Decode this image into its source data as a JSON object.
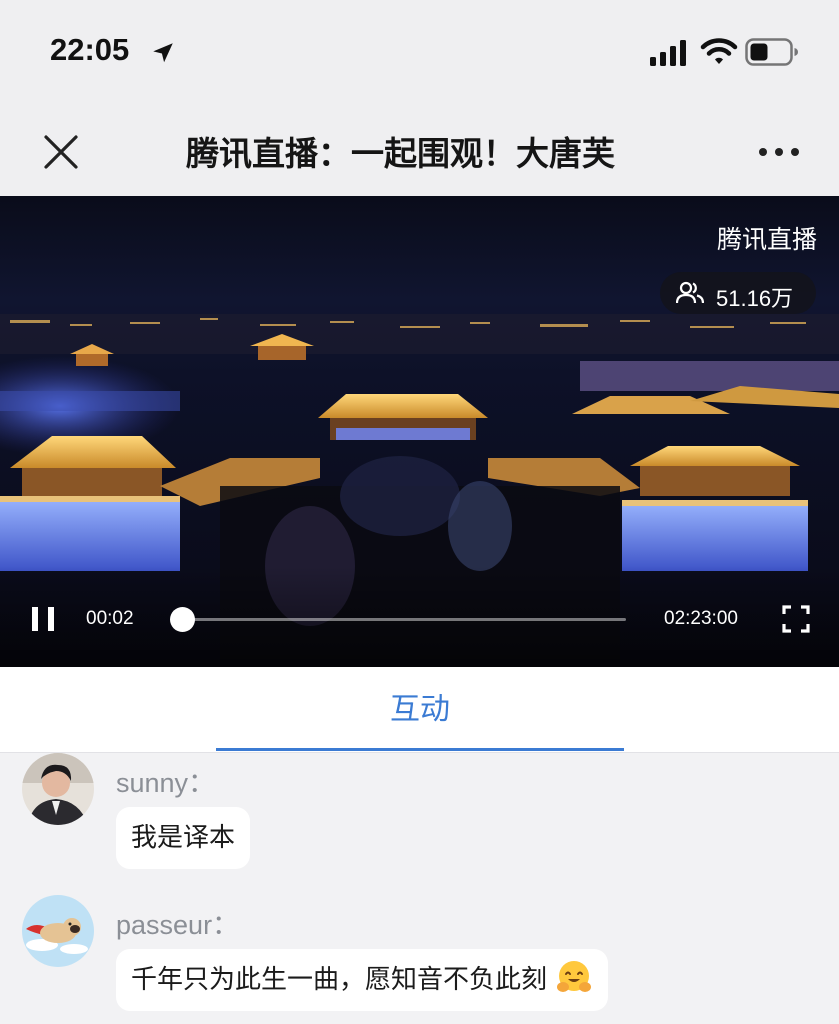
{
  "status_bar": {
    "time": "22:05",
    "icons": [
      "location-arrow-icon",
      "signal-icon",
      "wifi-icon",
      "battery-icon"
    ]
  },
  "nav": {
    "title": "腾讯直播：一起围观！大唐芙",
    "close_icon": "close-icon",
    "more_icon": "more-icon"
  },
  "video": {
    "channel": "腾讯直播",
    "viewers": "51.16万",
    "current_time": "00:02",
    "total_time": "02:23:00",
    "progress_fraction": 0.0002
  },
  "tabs": [
    {
      "label": "互动",
      "active": true
    }
  ],
  "comments": [
    {
      "user": "sunny：",
      "text": "我是译本"
    },
    {
      "user": "passeur：",
      "text": "千年只为此生一曲，愿知音不负此刻",
      "emoji": "hugging-face-emoji"
    }
  ],
  "colors": {
    "accent": "#3b7bd3",
    "background": "#f2f2f4",
    "username": "#8b8f96"
  }
}
